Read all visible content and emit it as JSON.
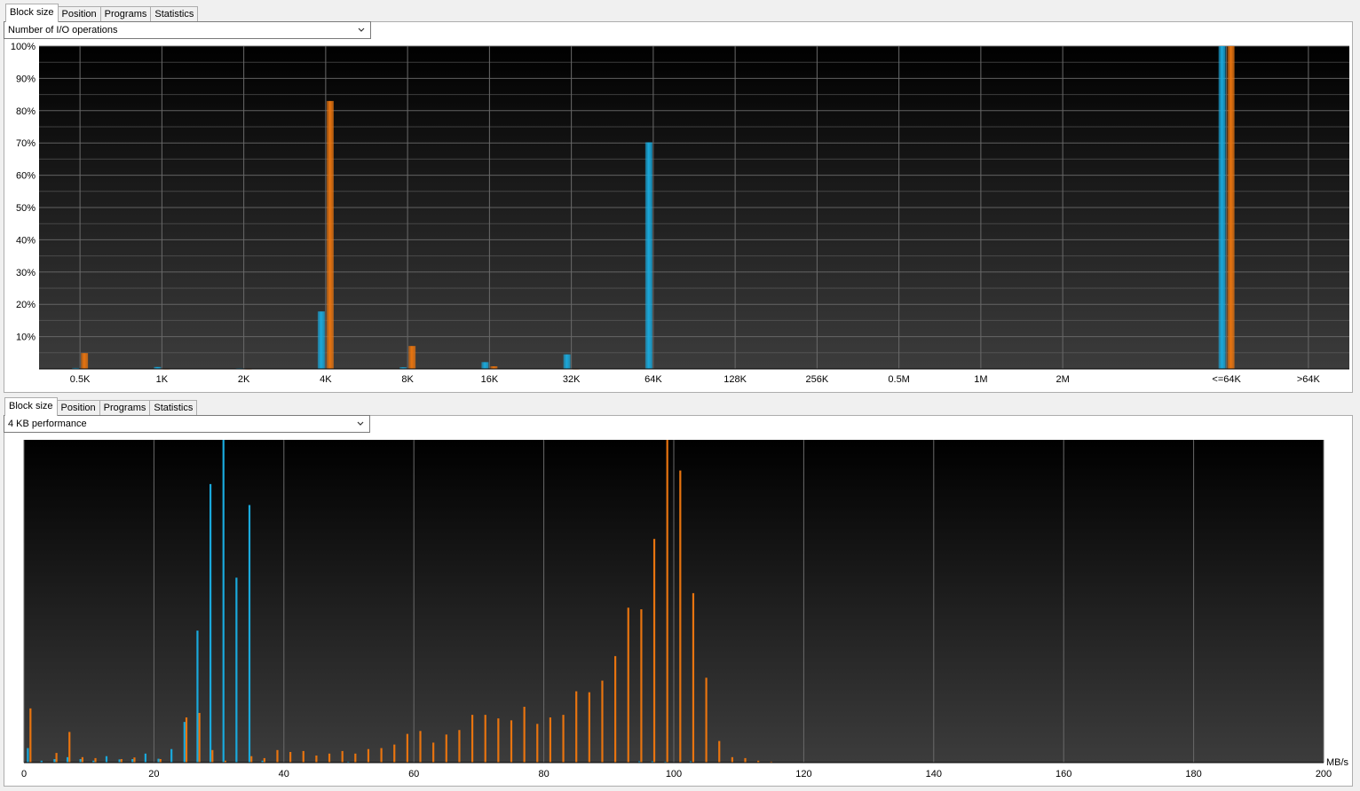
{
  "tabs_top": [
    "Block size",
    "Position",
    "Programs",
    "Statistics"
  ],
  "tabs_bottom": [
    "Block size",
    "Position",
    "Programs",
    "Statistics"
  ],
  "top_select": {
    "value": "Number of I/O operations"
  },
  "bottom_select": {
    "value": "4 KB performance"
  },
  "colors": {
    "read": "#1aa9dc",
    "write": "#e8740f",
    "plot_top": "#000000",
    "plot_bottom": "#3c3c3c"
  },
  "chart_data": [
    {
      "type": "bar",
      "categories": [
        "0.5K",
        "1K",
        "2K",
        "4K",
        "8K",
        "16K",
        "32K",
        "64K",
        "128K",
        "256K",
        "0.5M",
        "1M",
        "2M",
        "",
        "<=64K",
        ">64K"
      ],
      "series": [
        {
          "values": [
            0.3,
            0.6,
            0.2,
            17.8,
            0.5,
            2.1,
            4.5,
            70.2,
            0,
            0,
            0,
            0,
            0,
            0,
            100,
            0
          ]
        },
        {
          "values": [
            4.9,
            0.1,
            0.1,
            83.0,
            7.1,
            0.8,
            0.1,
            0,
            0,
            0,
            0,
            0,
            0,
            0,
            100,
            0
          ]
        }
      ],
      "yticks": [
        "10%",
        "20%",
        "30%",
        "40%",
        "50%",
        "60%",
        "70%",
        "80%",
        "90%",
        "100%"
      ],
      "ylim": [
        0,
        100
      ],
      "grid": true
    },
    {
      "type": "bar",
      "x_unit": "MB/s",
      "xticks": [
        "0",
        "20",
        "40",
        "60",
        "80",
        "100",
        "120",
        "140",
        "160",
        "180",
        "200"
      ],
      "xlim": [
        0,
        200
      ],
      "ylim": [
        0,
        100
      ],
      "grid": true,
      "series": [
        {
          "points": [
            [
              0.6,
              4.5
            ],
            [
              2.7,
              0.6
            ],
            [
              4.7,
              1.1
            ],
            [
              6.7,
              1.7
            ],
            [
              8.7,
              1.1
            ],
            [
              10.7,
              0.6
            ],
            [
              12.7,
              2.0
            ],
            [
              14.7,
              1.0
            ],
            [
              16.7,
              1.1
            ],
            [
              18.7,
              2.8
            ],
            [
              20.7,
              1.2
            ],
            [
              22.7,
              4.2
            ],
            [
              24.7,
              12.6
            ],
            [
              26.7,
              40.9
            ],
            [
              28.7,
              86.3
            ],
            [
              30.7,
              100
            ],
            [
              32.7,
              57.3
            ],
            [
              34.7,
              79.8
            ],
            [
              36.7,
              0.6
            ],
            [
              49.9,
              0.3
            ],
            [
              94.7,
              0.4
            ],
            [
              96.7,
              0.4
            ],
            [
              98.7,
              0.3
            ],
            [
              102.6,
              0.4
            ]
          ]
        },
        {
          "points": [
            [
              1.0,
              16.8
            ],
            [
              5.0,
              3.0
            ],
            [
              7.0,
              9.5
            ],
            [
              9.0,
              1.7
            ],
            [
              11.0,
              1.4
            ],
            [
              15.0,
              1.1
            ],
            [
              17.0,
              1.6
            ],
            [
              21.0,
              1.1
            ],
            [
              25.0,
              14.0
            ],
            [
              27.0,
              15.4
            ],
            [
              29.0,
              3.9
            ],
            [
              31.0,
              0.6
            ],
            [
              35.0,
              2.0
            ],
            [
              37.0,
              1.4
            ],
            [
              39.0,
              3.9
            ],
            [
              41.0,
              3.3
            ],
            [
              43.0,
              3.6
            ],
            [
              45.0,
              2.2
            ],
            [
              47.0,
              2.8
            ],
            [
              49.0,
              3.6
            ],
            [
              51.0,
              2.8
            ],
            [
              53.0,
              4.2
            ],
            [
              55.0,
              4.5
            ],
            [
              57.0,
              5.6
            ],
            [
              59.0,
              8.9
            ],
            [
              61.0,
              9.8
            ],
            [
              63.0,
              6.2
            ],
            [
              65.0,
              8.7
            ],
            [
              67.0,
              10.1
            ],
            [
              69.0,
              14.8
            ],
            [
              71.0,
              14.8
            ],
            [
              73.0,
              13.7
            ],
            [
              75.0,
              13.1
            ],
            [
              77.0,
              17.3
            ],
            [
              79.0,
              12.0
            ],
            [
              81.0,
              14.0
            ],
            [
              83.0,
              14.8
            ],
            [
              85.0,
              22.1
            ],
            [
              87.0,
              21.8
            ],
            [
              89.0,
              25.4
            ],
            [
              91.0,
              33.0
            ],
            [
              93.0,
              48.0
            ],
            [
              95.0,
              47.5
            ],
            [
              97.0,
              69.3
            ],
            [
              99.0,
              100
            ],
            [
              101.0,
              90.5
            ],
            [
              103.0,
              52.5
            ],
            [
              105.0,
              26.3
            ],
            [
              107.0,
              6.7
            ],
            [
              109.0,
              1.7
            ],
            [
              111.0,
              1.4
            ],
            [
              113.0,
              0.6
            ],
            [
              115.0,
              0.3
            ]
          ]
        }
      ]
    }
  ]
}
